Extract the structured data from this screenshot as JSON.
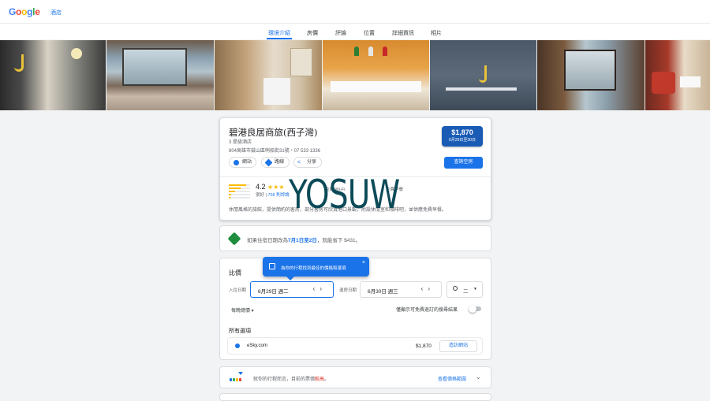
{
  "header": {
    "logo": "Google",
    "hotels_link": "酒店"
  },
  "tabs": [
    {
      "label": "環境介紹",
      "active": true
    },
    {
      "label": "房價",
      "active": false
    },
    {
      "label": "評論",
      "active": false
    },
    {
      "label": "位置",
      "active": false
    },
    {
      "label": "詳細資訊",
      "active": false
    },
    {
      "label": "相片",
      "active": false
    }
  ],
  "hotel": {
    "name": "碧港良居商旅(西子灣)",
    "class": "3 星級酒店",
    "address": "804高雄市鼓山區哨船街31號・07 533 1336",
    "price": "$1,870",
    "dates": "6月29日至30日",
    "book_label": "查詢空房",
    "chips": [
      "網站",
      "路線",
      "分享"
    ],
    "rating": "4.2",
    "stars": "★★★",
    "review_label": "很好",
    "review_count": "766 則評論",
    "amenities": [
      "免費 Wi-Fi",
      "免費早餐"
    ],
    "description": "休閒風格的旅館，提供簡約的客房，部分客房可欣賞港口景觀，附設休閒室和咖啡吧，並供應免費早餐。"
  },
  "watermark": "YOSUW",
  "deal": {
    "text_before": "如果住宿日期改為",
    "dates": "7月1日至2日",
    "text_after": "，就能省下 $431。"
  },
  "compare": {
    "title": "比價",
    "tooltip": "為你的行程找到最佳的價格和選項",
    "tooltip_close": "×",
    "checkin_label": "入住日期",
    "checkin_value": "6月29日 週二",
    "checkout_label": "退房日期",
    "checkout_value": "6月30日 週三",
    "guests": "二",
    "nightly": "每晚總價 ▾",
    "toggle_label": "僅顯示可免費退訂的搜尋結果",
    "all_options": "所有選項",
    "offers": [
      {
        "name": "eSky.com",
        "price": "$1,870",
        "action": "造訪網站"
      }
    ]
  },
  "insight": {
    "text_before": "就你的行程而言，目前的票價",
    "highlight": "較高",
    "text_after": "。",
    "link": "查看價格範圍"
  },
  "colors": {
    "accent": "#1a73e8",
    "price_badge": "#1a5bb5",
    "deal_green": "#1e8e3e",
    "high_red": "#d93025",
    "star": "#fbbc05"
  }
}
